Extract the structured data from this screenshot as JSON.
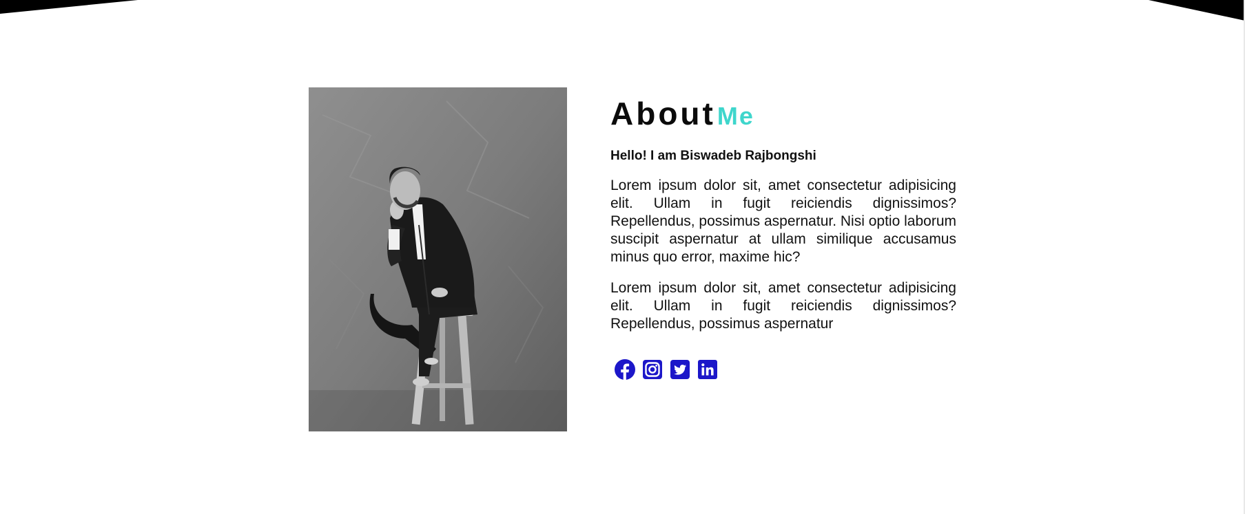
{
  "about": {
    "title_main": "About",
    "title_accent": "Me",
    "greeting": "Hello! I am Biswadeb Rajbongshi",
    "paragraphs": [
      "Lorem ipsum dolor sit, amet consectetur adipisicing elit. Ullam in fugit reiciendis dignissimos? Repellendus, possimus aspernatur. Nisi optio laborum suscipit aspernatur at ullam similique accusamus minus quo error, maxime hic?",
      "Lorem ipsum dolor sit, amet consectetur adipisicing elit. Ullam in fugit reiciendis dignissimos? Repellendus, possimus aspernatur"
    ]
  },
  "social": [
    {
      "icon": "facebook-icon"
    },
    {
      "icon": "instagram-icon"
    },
    {
      "icon": "twitter-icon"
    },
    {
      "icon": "linkedin-icon"
    }
  ],
  "colors": {
    "accent": "#3fd6cc",
    "social_icons": "#1c17c9",
    "heading": "#0b0b0b",
    "background": "#ffffff"
  }
}
